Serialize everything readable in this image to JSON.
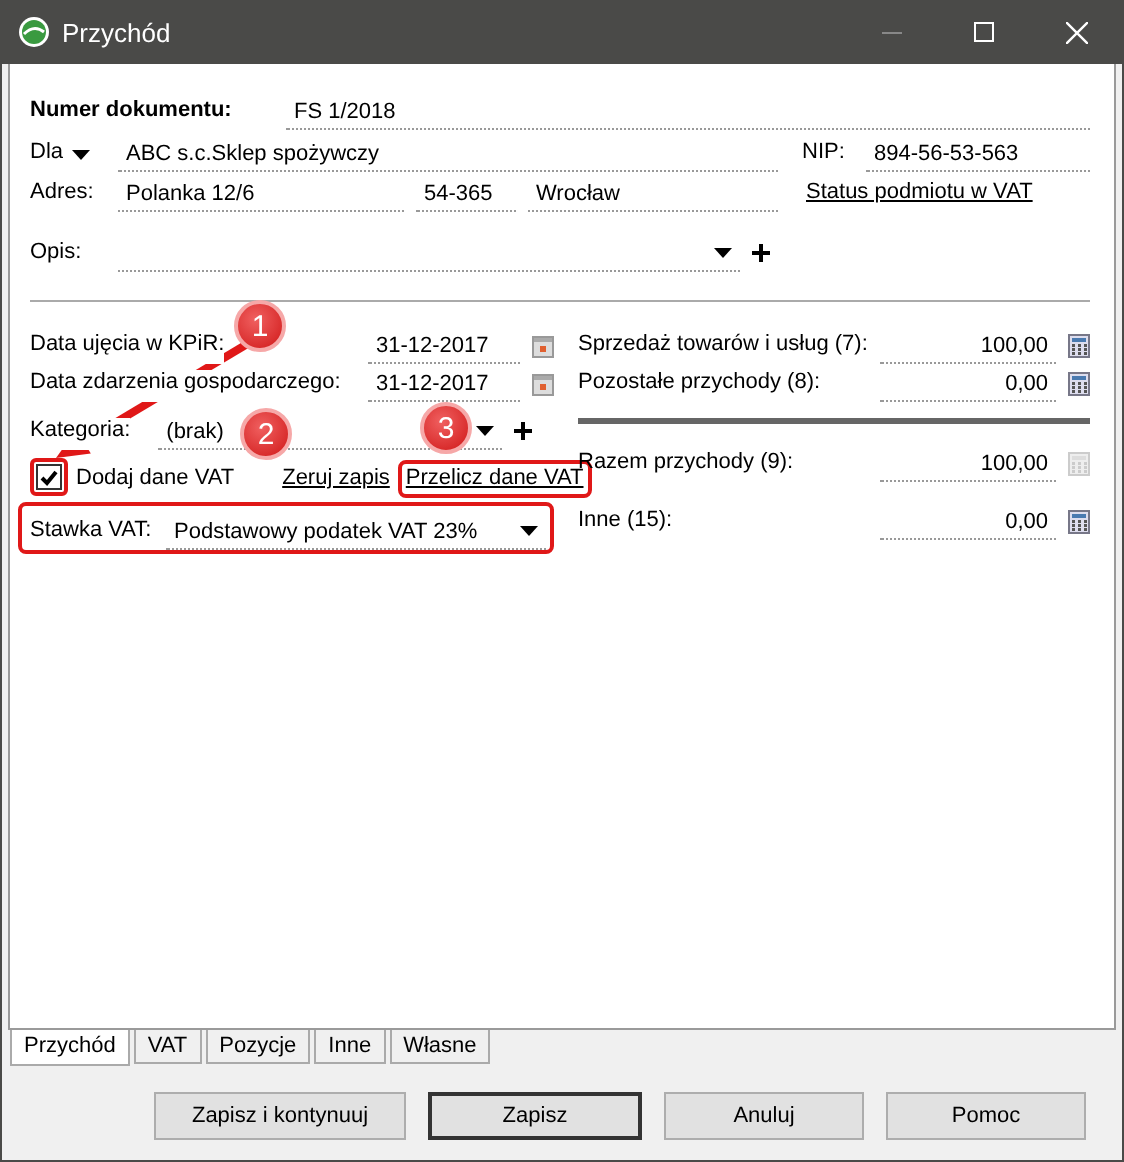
{
  "window": {
    "title": "Przychód"
  },
  "header": {
    "number_label": "Numer dokumentu:",
    "number": "FS 1/2018",
    "for_label": "Dla",
    "for_value": "ABC s.c.Sklep spożywczy",
    "nip_label": "NIP:",
    "nip": "894-56-53-563",
    "address_label": "Adres:",
    "street": "Polanka  12/6",
    "postcode": "54-365",
    "city": "Wrocław",
    "vat_status_link": "Status podmiotu w VAT",
    "description_label": "Opis:"
  },
  "left": {
    "dates": [
      {
        "label": "Data ujęcia w KPiR:",
        "value": "31-12-2017"
      },
      {
        "label": "Data zdarzenia gospodarczego:",
        "value": "31-12-2017"
      }
    ],
    "category_label": "Kategoria:",
    "category": "(brak)",
    "vat_checkbox": {
      "label": "Dodaj dane VAT",
      "checked": true
    },
    "reset_link": "Zeruj zapis",
    "recalc_link": "Przelicz dane VAT",
    "vat_rate_label": "Stawka VAT:",
    "vat_rate": "Podstawowy podatek VAT 23%"
  },
  "right": [
    {
      "label": "Sprzedaż towarów i usług (7):",
      "value": "100,00",
      "disabled": false
    },
    {
      "label": "Pozostałe przychody (8):",
      "value": "0,00",
      "disabled": false
    },
    {
      "label": "Razem przychody (9):",
      "value": "100,00",
      "disabled": true
    },
    {
      "label": "Inne (15):",
      "value": "0,00",
      "disabled": false
    }
  ],
  "annotations": [
    "1",
    "2",
    "3"
  ],
  "tabs": [
    {
      "label": "Przychód",
      "selected": true
    },
    {
      "label": "VAT",
      "selected": false
    },
    {
      "label": "Pozycje",
      "selected": false
    },
    {
      "label": "Inne",
      "selected": false
    },
    {
      "label": "Własne",
      "selected": false
    }
  ],
  "buttons": [
    {
      "label": "Zapisz i kontynuuj",
      "default": false
    },
    {
      "label": "Zapisz",
      "default": true
    },
    {
      "label": "Anuluj",
      "default": false
    },
    {
      "label": "Pomoc",
      "default": false
    }
  ]
}
